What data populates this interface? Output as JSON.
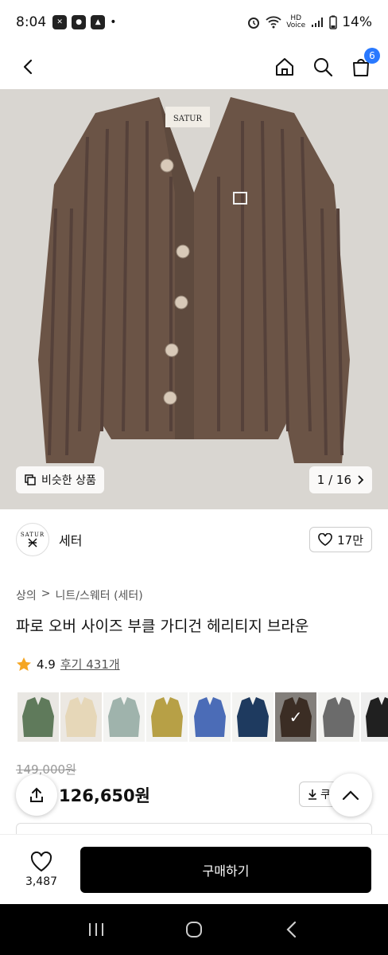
{
  "status_bar": {
    "time": "8:04",
    "battery": "14%",
    "hd_label": "HD",
    "volte_label": "Voice"
  },
  "header": {
    "cart_count": "6"
  },
  "hero": {
    "similar_label": "비슷한 상품",
    "counter": "1 / 16",
    "label_text": "SATUR",
    "colors": {
      "bg": "#d9d6d1",
      "knit": "#6b5446",
      "knit_dark": "#55413a",
      "button": "#d8c9b8"
    }
  },
  "brand": {
    "logo_text": "SATUR",
    "name": "세터",
    "likes": "17만"
  },
  "breadcrumb": {
    "level1": "상의",
    "separator": ">",
    "level2": "니트/스웨터 (세터)"
  },
  "product": {
    "title": "파로 오버 사이즈 부클 가디건 헤리티지 브라운",
    "rating": "4.9",
    "reviews": "후기 431개"
  },
  "color_thumbs": [
    {
      "color": "#5f7a5b",
      "bg": "#e9e7e3"
    },
    {
      "color": "#e6d7b8",
      "bg": "#ece8e2"
    },
    {
      "color": "#9fb3ac",
      "bg": "#f3f3f1"
    },
    {
      "color": "#b7a046",
      "bg": "#f3f3f1"
    },
    {
      "color": "#4b6cb7",
      "bg": "#f3f3f1"
    },
    {
      "color": "#1e3a5f",
      "bg": "#f3f3f1"
    },
    {
      "color": "#5b4538",
      "bg": "#c9c4bd",
      "selected": true
    },
    {
      "color": "#6b6b6b",
      "bg": "#f3f3f1"
    },
    {
      "color": "#202020",
      "bg": "#eeeeee"
    }
  ],
  "price": {
    "original": "149,000원",
    "sale": "126,650원",
    "coupon_label": "쿠"
  },
  "bottom_bar": {
    "wish_count": "3,487",
    "buy_label": "구매하기",
    "accent": "#000000"
  }
}
